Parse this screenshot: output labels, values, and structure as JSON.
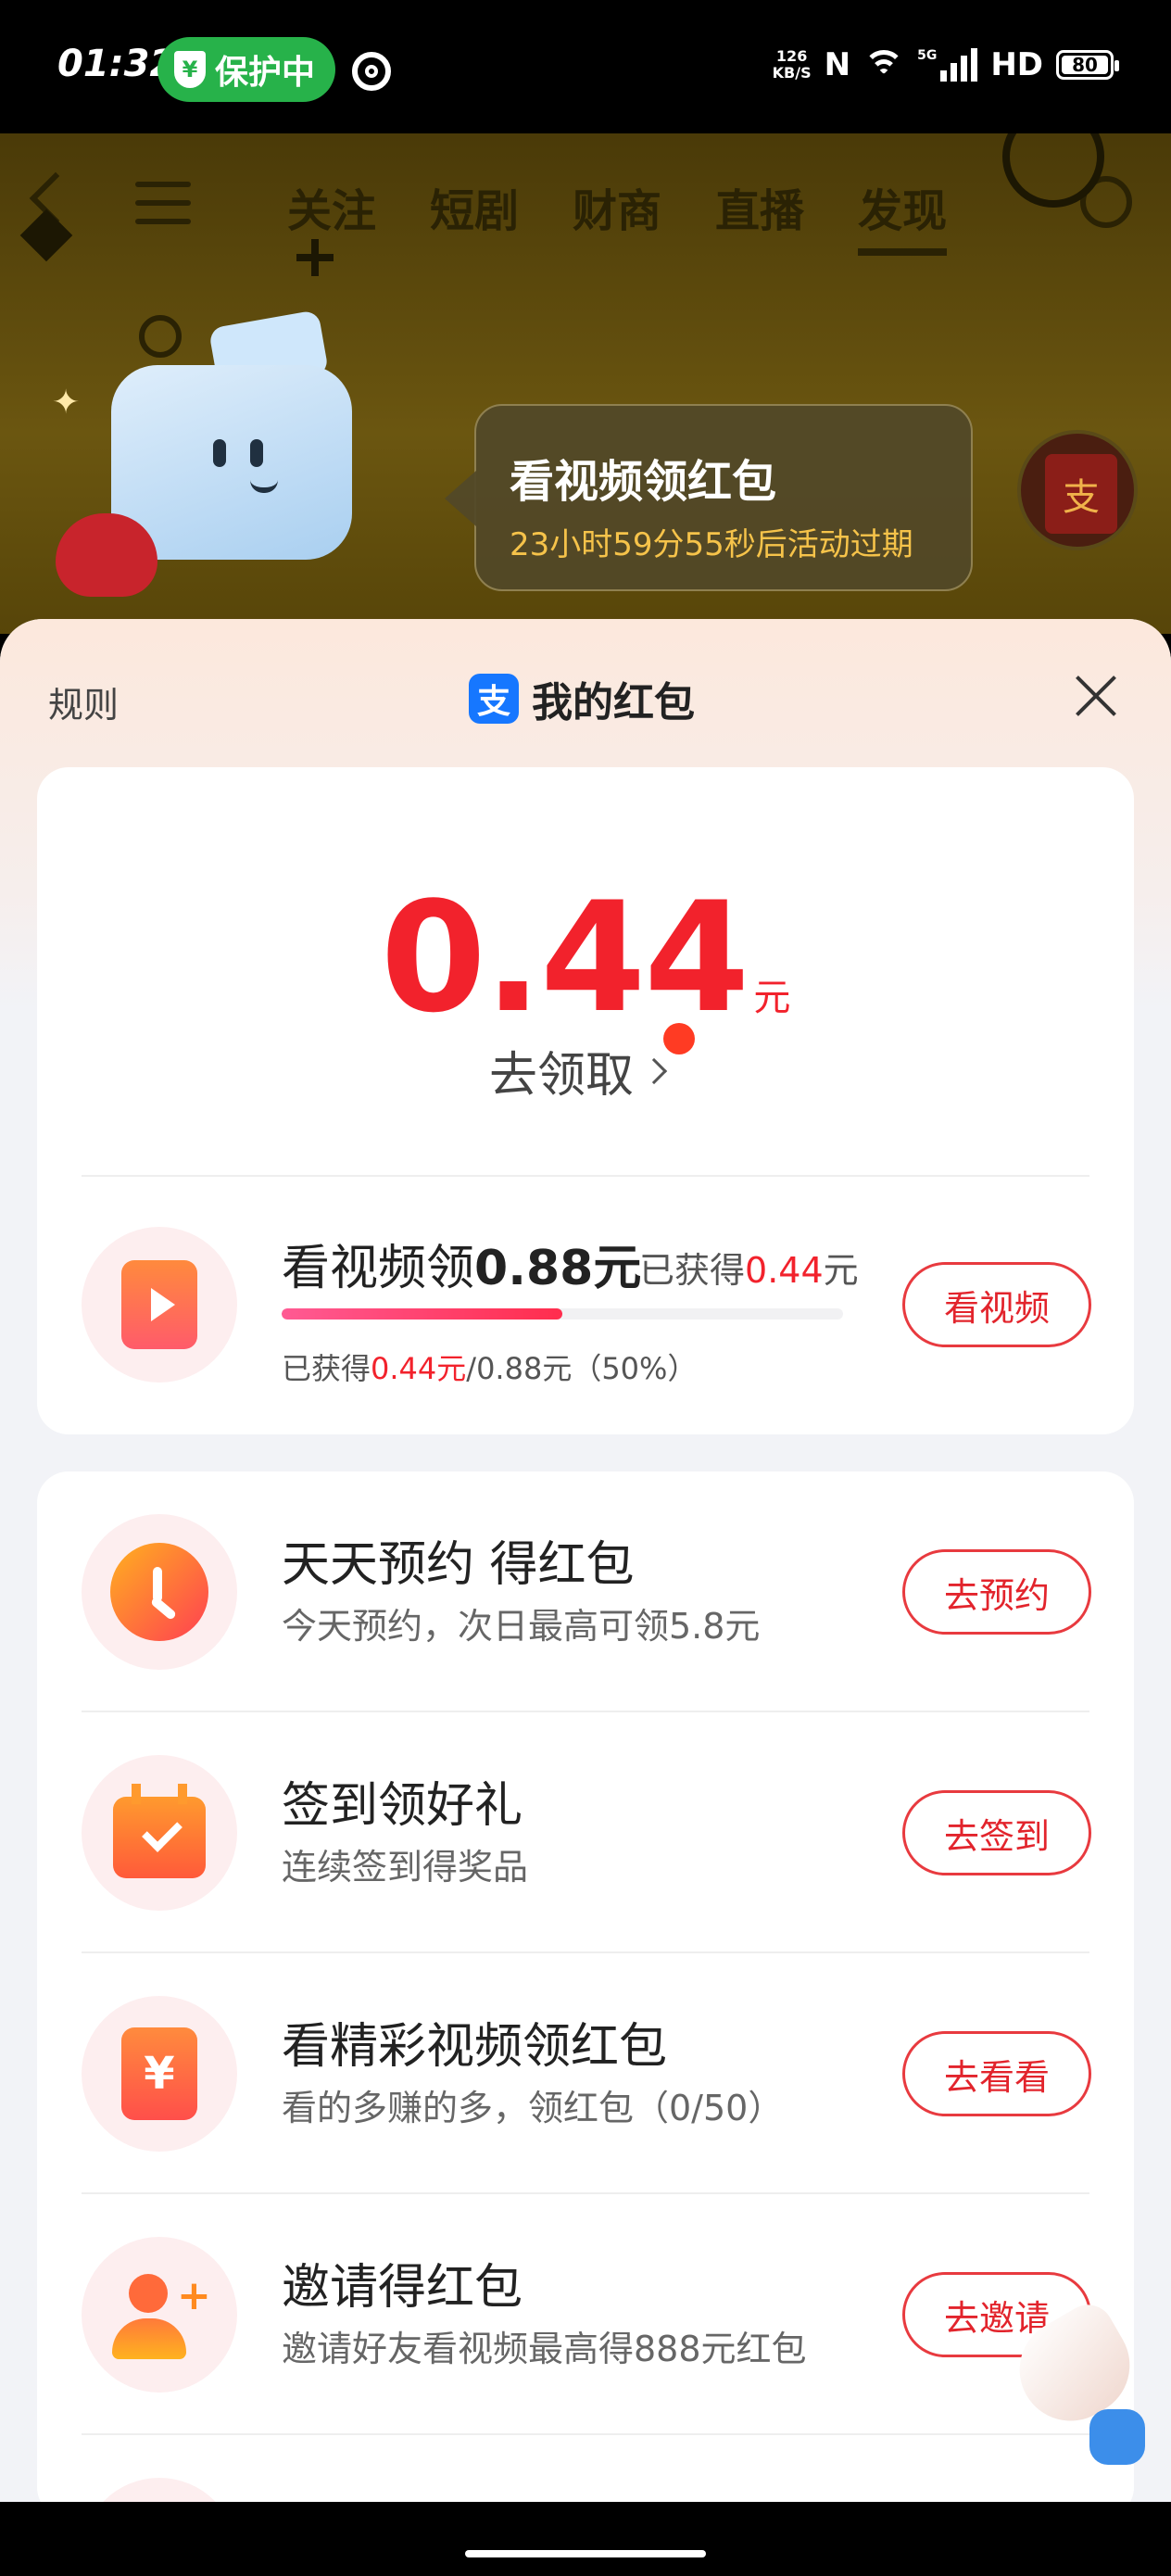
{
  "status_bar": {
    "time": "01:32",
    "protection_label": "保护中",
    "shield_symbol": "¥",
    "net_speed_value": "126",
    "net_speed_unit": "KB/S",
    "nfc": "N",
    "network": "5G",
    "hd": "HD",
    "battery": "80"
  },
  "background_app": {
    "tabs": [
      "关注",
      "短剧",
      "财商",
      "直播",
      "发现"
    ],
    "active_tab": "发现",
    "promo": {
      "title": "看视频领红包",
      "countdown": "23小时59分55秒后活动过期"
    },
    "badge_char": "支"
  },
  "sheet": {
    "rules_label": "规则",
    "title": "我的红包",
    "logo_char": "支",
    "balance": {
      "amount": "0.44",
      "unit": "元",
      "claim_label": "去领取"
    },
    "video_task": {
      "title_prefix": "看视频领",
      "title_amount": "0.88元",
      "earned_label": "已获得",
      "earned_amount": "0.44",
      "earned_unit": "元",
      "progress_label": "已获得",
      "progress_current": "0.44元",
      "progress_total": "/0.88元（50%）",
      "progress_fraction": 0.5,
      "button_label": "看视频"
    },
    "tasks": [
      {
        "title": "天天预约 得红包",
        "subtitle": "今天预约，次日最高可领5.8元",
        "button": "去预约",
        "icon": "clock-icon"
      },
      {
        "title": "签到领好礼",
        "subtitle": "连续签到得奖品",
        "button": "去签到",
        "icon": "calendar-check-icon"
      },
      {
        "title": "看精彩视频领红包",
        "subtitle": "看的多赚的多，领红包（0/50）",
        "button": "去看看",
        "icon": "yen-icon",
        "icon_symbol": "¥"
      },
      {
        "title": "邀请得红包",
        "subtitle": "邀请好友看视频最高得888元红包",
        "button": "去邀请",
        "icon": "invite-user-icon"
      }
    ]
  },
  "colors": {
    "accent_red": "#f2222c",
    "status_green": "#27b24a",
    "alipay_blue": "#1677ff"
  }
}
